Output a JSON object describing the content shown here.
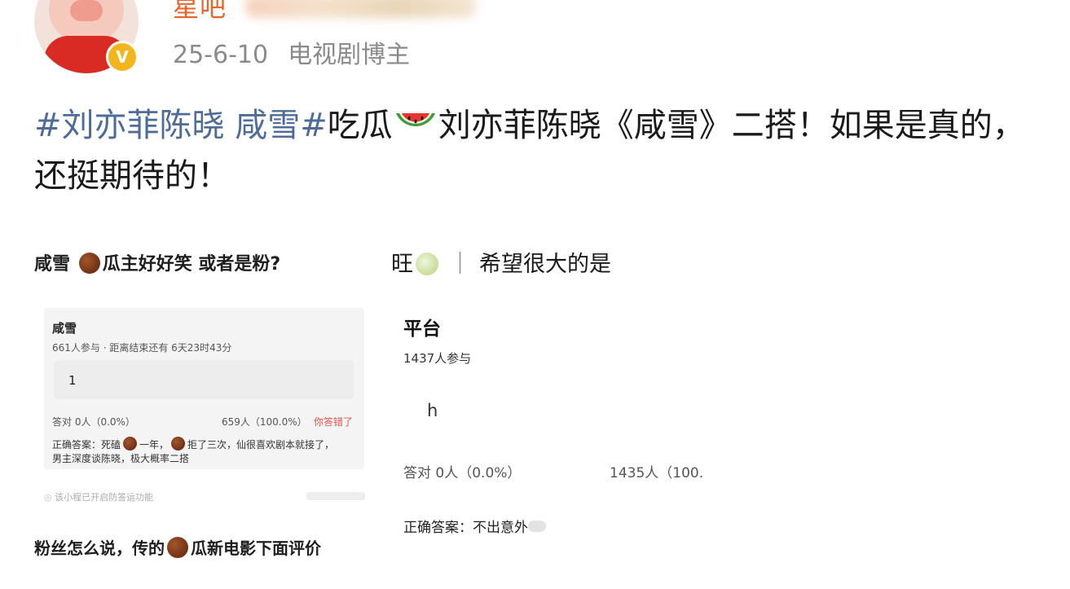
{
  "header": {
    "username_visible": "星吧",
    "date": "25-6-10",
    "account_type": "电视剧博主",
    "verify_badge": "V",
    "icons": [
      "avatar-pig",
      "verified-badge-icon"
    ]
  },
  "post": {
    "hashtag1": "#刘亦菲陈晓 咸雪#",
    "text1": "吃瓜",
    "emoji": "watermelon-icon",
    "text2": "刘亦菲陈晓《咸雪》二搭！如果是真的，还挺期待的！"
  },
  "left_image": {
    "title_a": "咸雪",
    "title_b": "瓜主好好笑 或者是粉?",
    "card": {
      "title": "咸雪",
      "subtitle": "661人参与 · 距离结束还有 6天23时43分",
      "option": "1",
      "correct_stat": "答对  0人（0.0%）",
      "wrong_stat": "659人（100.0%）",
      "wrong_label": "你答错了",
      "answer_a": "正确答案：死磕",
      "answer_b": "一年，",
      "answer_c": "拒了三次，仙很喜欢剧本就接了，",
      "answer_d": "男主深度谈陈晓，极大概率二搭",
      "footer": "该小程已开启防答运功能"
    },
    "caption_a": "粉丝怎么说，传的",
    "caption_b": "瓜新电影下面评价"
  },
  "right_image": {
    "title_a": "旺",
    "title_sep": "｜",
    "title_b": "希望很大的是",
    "card_title": "平台",
    "participants": "1437人参与",
    "option": "h",
    "correct_stat": "答对  0人（0.0%）",
    "wrong_stat": "1435人（100.0",
    "answer": "正确答案：不出意外"
  },
  "colors": {
    "tag": "#4d6c99",
    "username": "#e8642b",
    "verify": "#f3b51b",
    "wrong": "#e0554a"
  }
}
